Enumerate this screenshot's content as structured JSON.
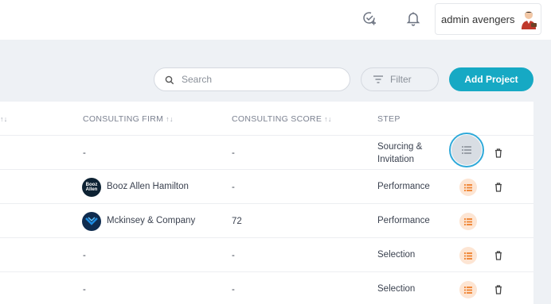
{
  "header": {
    "user_name": "admin avengers",
    "icons": [
      "check-add-icon",
      "bell-icon",
      "avatar"
    ]
  },
  "toolbar": {
    "search_placeholder": "Search",
    "filter_label": "Filter",
    "add_label": "Add Project"
  },
  "table": {
    "headers": {
      "first_sort": "↑↓",
      "firm": "CONSULTING FIRM",
      "firm_sort": "↑↓",
      "score": "CONSULTING SCORE",
      "score_sort": "↑↓",
      "step": "STEP"
    },
    "rows": [
      {
        "firm": "-",
        "score": "-",
        "step_line1": "Sourcing &",
        "step_line2": "Invitation"
      },
      {
        "firm": "Booz Allen Hamilton",
        "logo_text": "Booz Allen",
        "score": "-",
        "step": "Performance"
      },
      {
        "firm": "Mckinsey & Company",
        "score": "72",
        "step": "Performance"
      },
      {
        "firm": "-",
        "score": "-",
        "step": "Selection"
      },
      {
        "firm": "-",
        "score": "-",
        "step": "Selection"
      }
    ]
  },
  "colors": {
    "accent": "#16a9c4",
    "action_bg": "#fde5d3",
    "action_icon": "#f08a3c",
    "focus_ring": "#2fa9d9"
  }
}
